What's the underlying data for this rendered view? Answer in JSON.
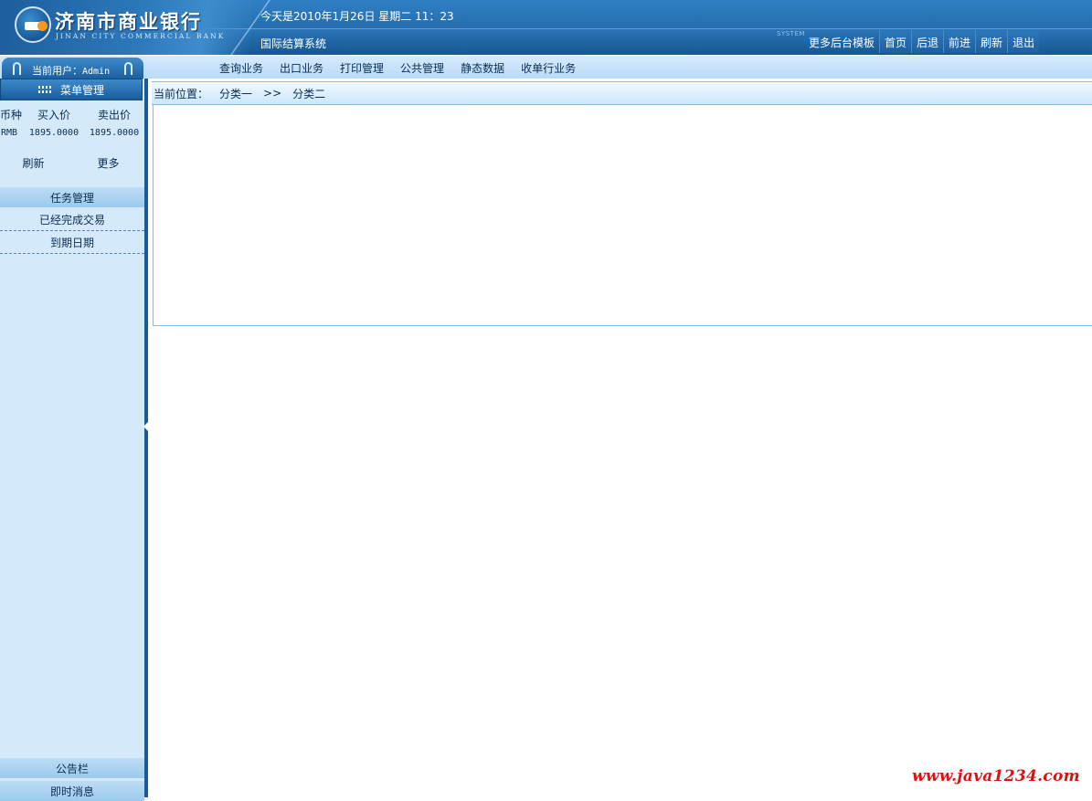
{
  "header": {
    "logo_cn": "济南市商业银行",
    "logo_en": "JINAN CITY COMMERCIAL BANK",
    "date_text": "今天是2010年1月26日 星期二 11：23",
    "system_name": "国际结算系统",
    "system_label": "SYSTEM",
    "links": [
      "更多后台模板",
      "首页",
      "后退",
      "前进",
      "刷新",
      "退出"
    ]
  },
  "user": {
    "label": "当前用户：",
    "name": "Admin"
  },
  "nav": {
    "items": [
      "查询业务",
      "出口业务",
      "打印管理",
      "公共管理",
      "静态数据",
      "收单行业务"
    ]
  },
  "sidebar": {
    "menu_title": "菜单管理",
    "rates": {
      "headers": [
        "币种",
        "买入价",
        "卖出价"
      ],
      "rows": [
        {
          "currency": "RMB",
          "buy": "1895.0000",
          "sell": "1895.0000"
        }
      ]
    },
    "refresh_label": "刷新",
    "more_label": "更多",
    "task_section": "任务管理",
    "task_items": [
      "已经完成交易",
      "到期日期"
    ],
    "notice_section": "公告栏",
    "message_section": "即时消息"
  },
  "breadcrumb": {
    "label": "当前位置：",
    "level1": "分类一",
    "separator": ">>",
    "level2": "分类二"
  },
  "watermark": "www.java1234.com",
  "colors": {
    "header_blue": "#1c5f9e",
    "sidebar_bg": "#d4eafa",
    "nav_bg": "#c9e3f8",
    "watermark_red": "#e01010"
  }
}
